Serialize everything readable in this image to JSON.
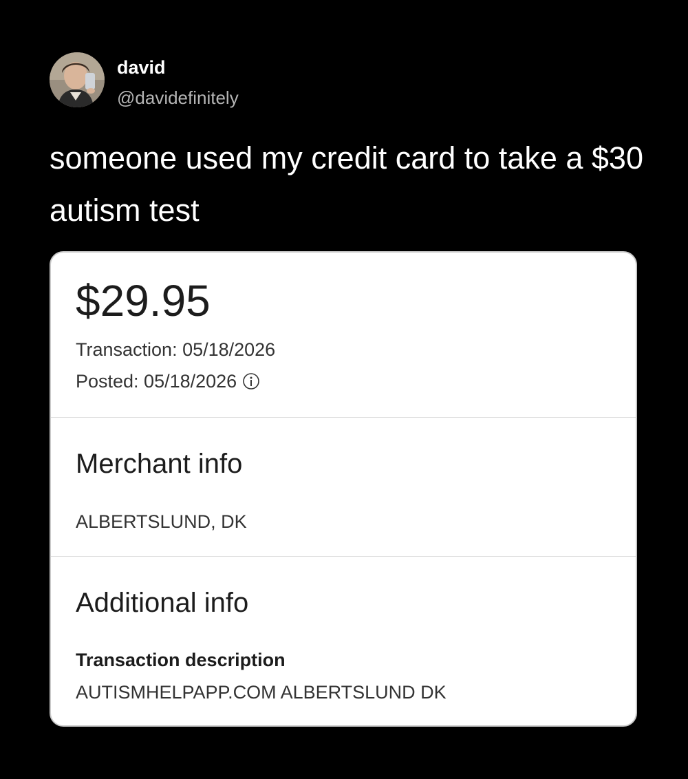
{
  "author": {
    "display_name": "david",
    "handle": "@davidefinitely",
    "avatar_icon": "profile-photo"
  },
  "tweet": {
    "text": "someone used my credit card to take a $30 autism test"
  },
  "transaction_card": {
    "amount": "$29.95",
    "transaction_date": "Transaction: 05/18/2026",
    "posted_date": "Posted: 05/18/2026",
    "info_icon": "info-circle-icon",
    "merchant_section": {
      "title": "Merchant info",
      "location": "ALBERTSLUND, DK"
    },
    "additional_section": {
      "title": "Additional info",
      "description_label": "Transaction description",
      "description_value": "AUTISMHELPAPP.COM ALBERTSLUND DK"
    }
  },
  "colors": {
    "background": "#000000",
    "primary_text": "#ffffff",
    "secondary_text": "#b5b5b5",
    "card_background": "#ffffff",
    "card_text": "#1c1c1c"
  }
}
